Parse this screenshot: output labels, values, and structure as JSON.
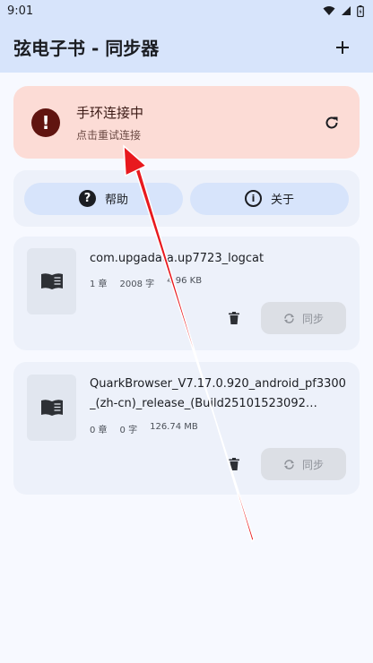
{
  "status_bar": {
    "time": "9:01"
  },
  "app_bar": {
    "title": "弦电子书 - 同步器",
    "add_label": "+"
  },
  "alert": {
    "icon": "error-icon",
    "title": "手环连接中",
    "subtitle": "点击重试连接",
    "refresh_icon": "refresh-icon",
    "color": "#fcdcd6"
  },
  "actions": {
    "help_label": "帮助",
    "help_glyph": "?",
    "about_label": "关于",
    "about_glyph": "i"
  },
  "books": [
    {
      "title": "com.upgadata.up7723_logcat",
      "chapters": "1 章",
      "chars": "2008 字",
      "size": "4.96 KB",
      "sync_label": "同步"
    },
    {
      "title": "QuarkBrowser_V7.17.0.920_android_pf3300_(zh-cn)_release_(Build25101523092…",
      "chapters": "0 章",
      "chars": "0 字",
      "size": "126.74 MB",
      "sync_label": "同步"
    }
  ],
  "colors": {
    "accent": "#d7e4fb",
    "annotation_arrow": "#e8191e",
    "alert": "#fcdcd6"
  }
}
